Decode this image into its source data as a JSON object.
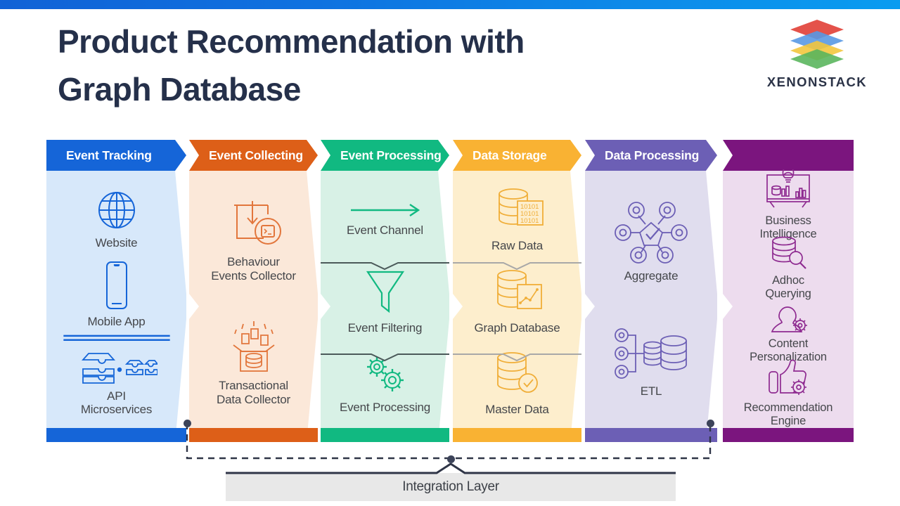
{
  "topbar": {
    "gradient_from": "#1162d6",
    "gradient_to": "#0a9cf0"
  },
  "header": {
    "title_line1": "Product Recommendation with",
    "title_line2": "Graph Database",
    "title_color": "#25304a"
  },
  "logo": {
    "wordmark": "XENONSTACK",
    "layer_colors": [
      "#e2443b",
      "#4a90e2",
      "#f2c12e",
      "#4caf50"
    ]
  },
  "pipeline": {
    "columns": [
      {
        "id": "event-tracking",
        "header": "Event Tracking",
        "header_color": "#1565d8",
        "body_color": "#d7e8fa",
        "icon_color": "#1565d8",
        "items": [
          {
            "label": "Website",
            "icon": "globe-icon"
          },
          {
            "label": "Mobile App",
            "icon": "mobile-phone-icon"
          },
          {
            "label": "API\nMicroservices",
            "icon": "api-trays-icon"
          }
        ],
        "dividers": []
      },
      {
        "id": "event-collecting",
        "header": "Event Collecting",
        "header_color": "#dd5f18",
        "body_color": "#fbe8d9",
        "icon_color": "#e2763c",
        "items": [
          {
            "label": "Behaviour\nEvents Collector",
            "icon": "inbox-download-terminal-icon"
          },
          {
            "label": "Transactional\nData Collector",
            "icon": "open-box-documents-database-icon"
          }
        ],
        "dividers": []
      },
      {
        "id": "event-processing",
        "header": "Event Processing",
        "header_color": "#11b981",
        "body_color": "#d8f1e6",
        "icon_color": "#11b981",
        "items": [
          {
            "label": "Event Channel",
            "icon": "arrow-right-icon"
          },
          {
            "label": "Event Filtering",
            "icon": "funnel-icon"
          },
          {
            "label": "Event Processing",
            "icon": "gears-icon"
          }
        ],
        "dividers": [
          "#4b5a5a",
          "#4b5a5a"
        ]
      },
      {
        "id": "data-storage",
        "header": "Data Storage",
        "header_color": "#f9b233",
        "body_color": "#fdeecd",
        "icon_color": "#f0ae38",
        "items": [
          {
            "label": "Raw Data",
            "icon": "database-binary-icon",
            "binary": "10101"
          },
          {
            "label": "Graph Database",
            "icon": "database-chart-icon"
          },
          {
            "label": "Master Data",
            "icon": "database-check-icon"
          }
        ],
        "dividers": [
          "#a8a8a8",
          "#a8a8a8"
        ]
      },
      {
        "id": "data-processing",
        "header": "Data Processing",
        "header_color": "#6c5fb5",
        "body_color": "#e0ddee",
        "icon_color": "#6c5fb5",
        "items": [
          {
            "label": "Aggregate",
            "icon": "network-nodes-check-icon"
          },
          {
            "label": "ETL",
            "icon": "etl-nodes-database-icon"
          }
        ],
        "dividers": []
      },
      {
        "id": "outcomes",
        "header": "",
        "header_color": "#7b157e",
        "body_color": "#eddcee",
        "icon_color": "#8e2a90",
        "items": [
          {
            "label": "Business\nIntelligence",
            "icon": "dashboard-bulb-icon"
          },
          {
            "label": "Adhoc\nQuerying",
            "icon": "database-search-icon"
          },
          {
            "label": "Content\nPersonalization",
            "icon": "person-gear-icon"
          },
          {
            "label": "Recommendation\nEngine",
            "icon": "thumbs-up-gear-icon"
          }
        ],
        "dividers": []
      }
    ]
  },
  "integration": {
    "label": "Integration Layer",
    "bar_color": "#e8e8e8",
    "line_color": "#3c4359"
  }
}
